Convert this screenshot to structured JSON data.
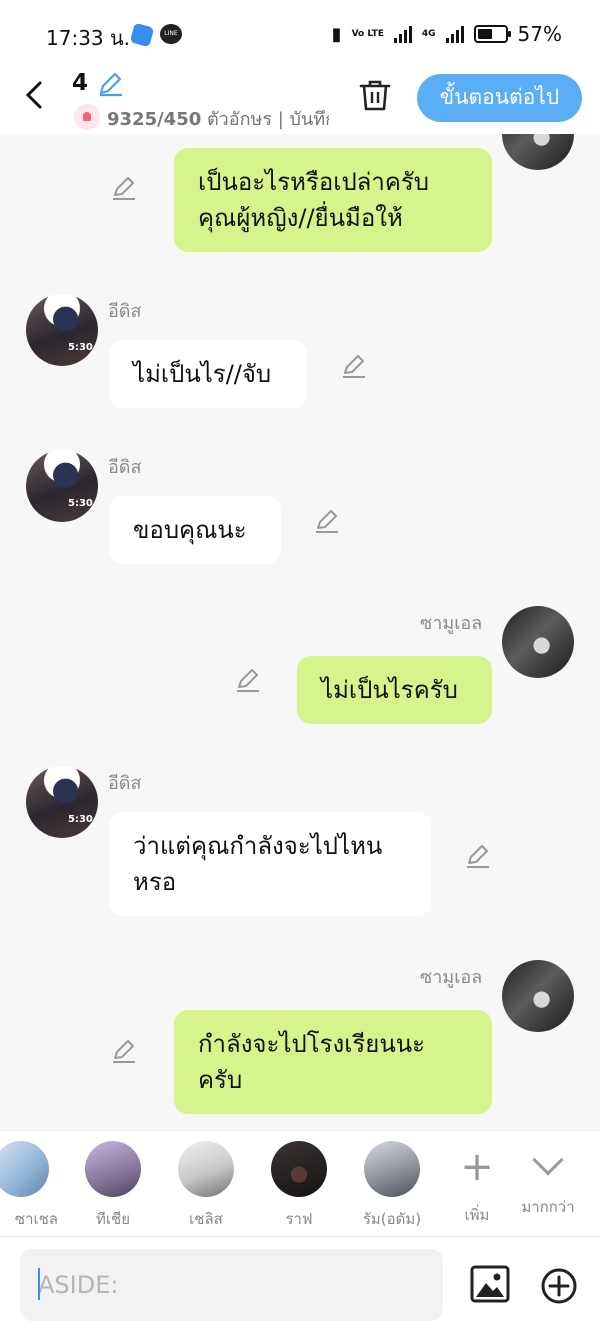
{
  "status": {
    "time": "17:33 น.",
    "battery": "57%",
    "network": "4G",
    "volte": "Vo LTE"
  },
  "header": {
    "episode": "4",
    "chars": "9325/450",
    "chars_suffix": " ตัวอักษร | บันทึก",
    "next_label": "ขั้นตอนต่อไป"
  },
  "messages": [
    {
      "side": "right",
      "text_line1": "เป็นอะไรหรือเปล่าครับ",
      "text_line2": "คุณผู้หญิง//ยื่นมือให้"
    },
    {
      "side": "left",
      "name": "อีดิส",
      "text": "ไม่เป็นไร//จับ"
    },
    {
      "side": "left",
      "name": "อีดิส",
      "text": "ขอบคุณนะ"
    },
    {
      "side": "right",
      "name": "ซามูเอล",
      "text": "ไม่เป็นไรครับ"
    },
    {
      "side": "left",
      "name": "อีดิส",
      "text_line1": "ว่าแต่คุณกำลังจะไปไหน",
      "text_line2": "หรอ"
    },
    {
      "side": "right",
      "name": "ซามูเอล",
      "text_line1": "กำลังจะไปโรงเรียนนะ",
      "text_line2": "ครับ"
    }
  ],
  "avatar_time": "5:30",
  "characters": [
    {
      "name": "ซาเชล",
      "color": "#8fb4d6"
    },
    {
      "name": "ทีเชีย",
      "color": "#b5a6c8"
    },
    {
      "name": "เชลิส",
      "color": "#d9d9d9"
    },
    {
      "name": "ราฟ",
      "color": "#2a2626"
    },
    {
      "name": "รัม(อดัม)",
      "color": "#9a9ea6"
    }
  ],
  "actions": {
    "add_label": "เพิ่ม",
    "more_label": "มากกว่า"
  },
  "input": {
    "placeholder": "ASIDE:"
  },
  "colors": {
    "accent": "#5aaef6",
    "right_bubble": "#d6f48b",
    "left_bubble": "#ffffff"
  }
}
